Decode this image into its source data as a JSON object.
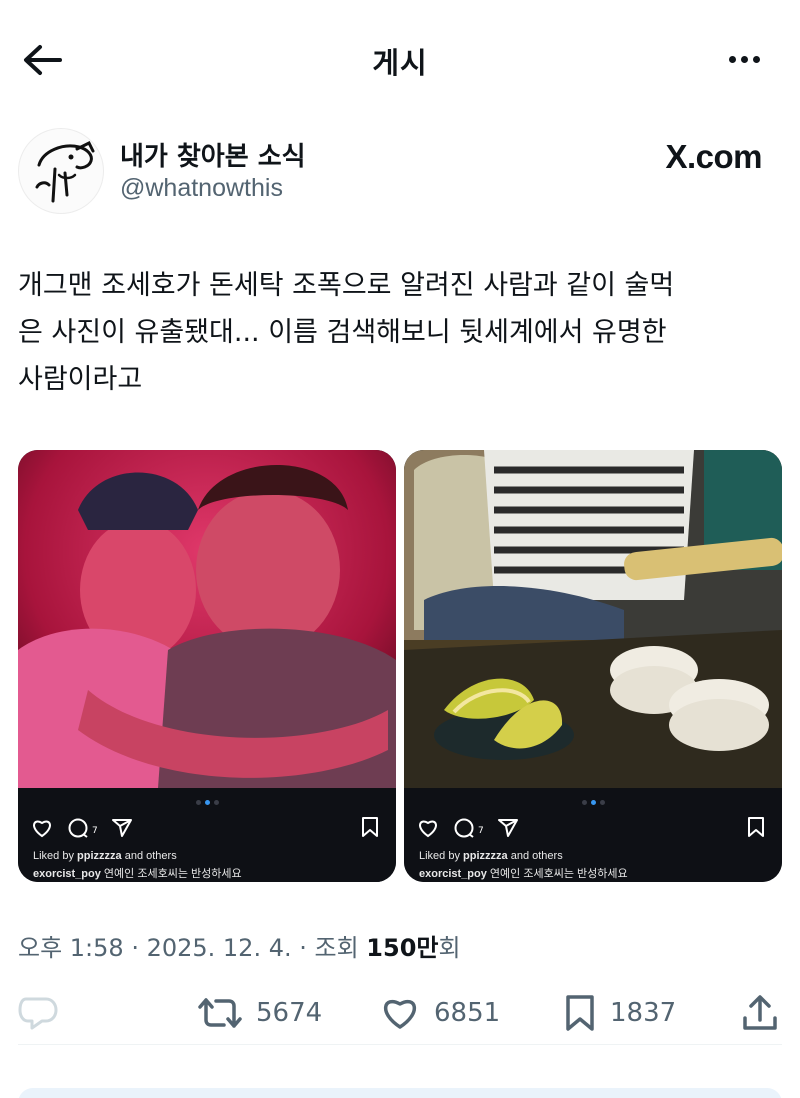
{
  "header": {
    "title": "게시",
    "back_icon": "arrow-left-icon",
    "more_icon": "more-dots-icon"
  },
  "author": {
    "name": "내가 찾아본 소식",
    "handle": "@whatnowthis",
    "source": "X.com"
  },
  "post": {
    "text": "개그맨 조세호가 돈세탁 조폭으로 알려진 사람과 같이 술먹\n은 사진이 유출됐대... 이름 검색해보니 뒷세계에서 유명한\n사람이라고"
  },
  "media": [
    {
      "comment_count": "7",
      "liked_by_prefix": "Liked by ",
      "liked_by_user": "ppizzzza",
      "liked_by_suffix": " and others",
      "caption_user": "exorcist_poy",
      "caption_text": " 연예인 조세호씨는 반성하세요"
    },
    {
      "comment_count": "7",
      "liked_by_prefix": "Liked by ",
      "liked_by_user": "ppizzzza",
      "liked_by_suffix": " and others",
      "caption_user": "exorcist_poy",
      "caption_text": " 연예인 조세호씨는 반성하세요"
    }
  ],
  "meta": {
    "time": "오후 1:58",
    "separator": " · ",
    "date": "2025. 12. 4.",
    "views_label": "조회 ",
    "views_value": "150만",
    "views_suffix": "회"
  },
  "actions": {
    "replies": "",
    "retweets": "5674",
    "likes": "6851",
    "bookmarks": "1837"
  },
  "colors": {
    "text": "#0f1419",
    "secondary": "#536471",
    "ig_bar": "#0e1015"
  }
}
